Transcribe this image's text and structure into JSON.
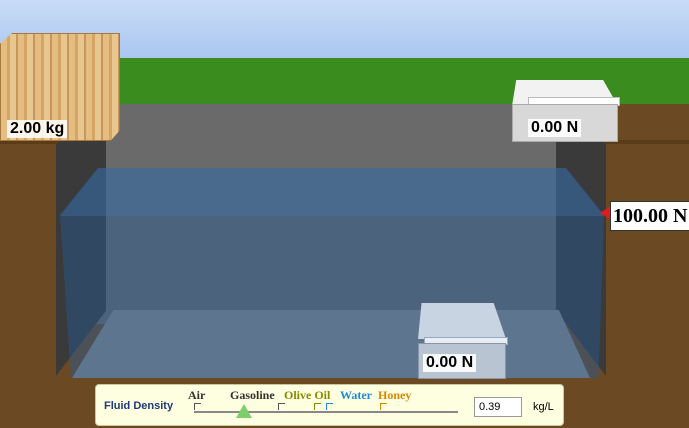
{
  "wood_block": {
    "mass_label": "2.00 kg"
  },
  "scales": {
    "top_scale_reading": "0.00 N",
    "pool_scale_reading": "0.00 N"
  },
  "pressure_readout": "100.00 N",
  "fluid_panel": {
    "title": "Fluid Density",
    "fluids": [
      {
        "name": "Air",
        "color": "#333333"
      },
      {
        "name": "Gasoline",
        "color": "#333333"
      },
      {
        "name": "Olive Oil",
        "color": "#8a8a00"
      },
      {
        "name": "Water",
        "color": "#1f8ad6"
      },
      {
        "name": "Honey",
        "color": "#d78a00"
      }
    ],
    "density_value": "0.39",
    "unit": "kg/L",
    "selected_fraction": 0.19
  },
  "colors": {
    "sky": "#b8d0f3",
    "grass": "#3a8c1f",
    "ground": "#6b4a23",
    "water": "#28629a",
    "pressure_arrow": "#e21a1a"
  }
}
